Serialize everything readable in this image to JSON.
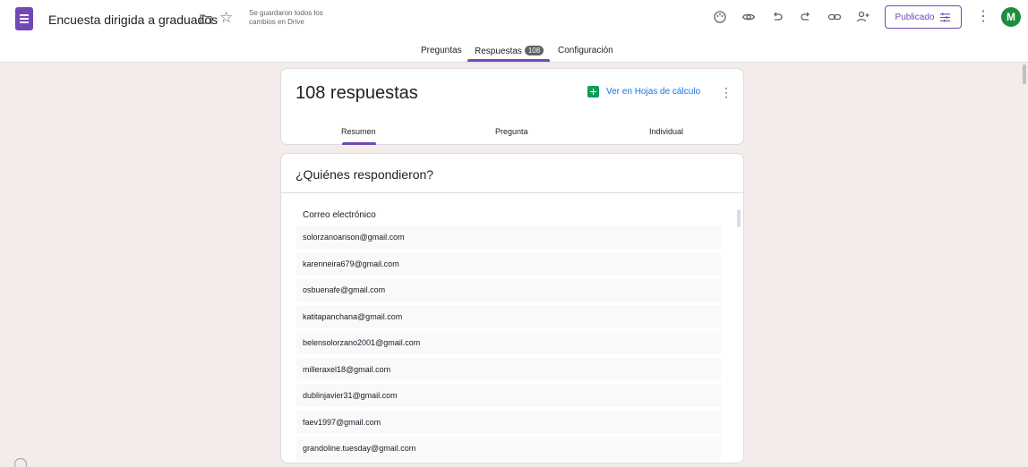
{
  "header": {
    "title": "Encuesta dirigida a graduados",
    "save_status": "Se guardaron todos los cambios en Drive",
    "publish_label": "Publicado",
    "avatar_initial": "M",
    "icons": [
      "palette-icon",
      "preview-icon",
      "undo-icon",
      "redo-icon",
      "link-icon",
      "add-collaborator-icon"
    ]
  },
  "tabs": {
    "questions": "Preguntas",
    "responses": "Respuestas",
    "responses_count": "108",
    "settings": "Configuración"
  },
  "summary": {
    "count_label": "108 respuestas",
    "sheets_link": "Ver en Hojas de cálculo",
    "subtabs": [
      "Resumen",
      "Pregunta",
      "Individual"
    ]
  },
  "who": {
    "title": "¿Quiénes respondieron?",
    "email_label": "Correo electrónico",
    "emails": [
      "solorzanoarison@gmail.com",
      "karenneira679@gmail.com",
      "osbuenafe@gmail.com",
      "katitapanchana@gmail.com",
      "belensolorzano2001@gmail.com",
      "milleraxel18@gmail.com",
      "dublinjavier31@gmail.com",
      "faev1997@gmail.com",
      "grandoline.tuesday@gmail.com"
    ]
  },
  "colors": {
    "accent": "#7248b9",
    "link": "#1a73e8",
    "sheets": "#0f9d58",
    "avatar": "#1e8e3e",
    "background": "#f3ecea"
  }
}
